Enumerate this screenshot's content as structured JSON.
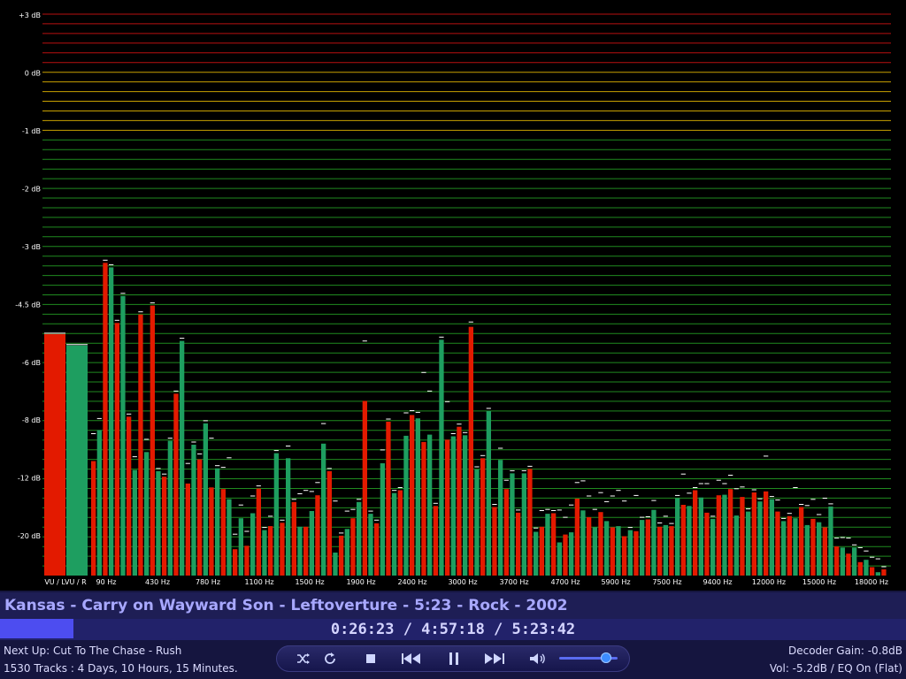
{
  "chart_data": {
    "type": "bar",
    "title": "",
    "ylabels": [
      "+3 dB",
      "0 dB",
      "-1 dB",
      "-2 dB",
      "-3 dB",
      "-4.5 dB",
      "-6 dB",
      "-8 dB",
      "-12 dB",
      "-20 dB"
    ],
    "xlabels": [
      "VU / LVU / R",
      "90 Hz",
      "430 Hz",
      "780 Hz",
      "1100 Hz",
      "1500 Hz",
      "1900 Hz",
      "2400 Hz",
      "3000 Hz",
      "3700 Hz",
      "4700 Hz",
      "5900 Hz",
      "7500 Hz",
      "9400 Hz",
      "12000 Hz",
      "15000 Hz",
      "18000 Hz"
    ],
    "vu": [
      {
        "channel": "L",
        "level": 0.43,
        "color": "#e31a00"
      },
      {
        "channel": "R",
        "level": 0.41,
        "color": "#1e9e60"
      }
    ],
    "bars": [
      {
        "level": 0.204,
        "peak": 0.248
      },
      {
        "level": 0.259,
        "peak": 0.275
      },
      {
        "level": 0.557,
        "peak": 0.557
      },
      {
        "level": 0.549,
        "peak": 0.549
      },
      {
        "level": 0.45,
        "peak": 0.45
      },
      {
        "level": 0.498,
        "peak": 0.498
      },
      {
        "level": 0.283,
        "peak": 0.283
      },
      {
        "level": 0.188,
        "peak": 0.207
      },
      {
        "level": 0.465,
        "peak": 0.465
      },
      {
        "level": 0.22,
        "peak": 0.238
      },
      {
        "level": 0.481,
        "peak": 0.481
      },
      {
        "level": 0.186,
        "peak": 0.186
      },
      {
        "level": 0.176,
        "peak": 0.176
      },
      {
        "level": 0.24,
        "peak": 0.24
      },
      {
        "level": 0.324,
        "peak": 0.324
      },
      {
        "level": 0.418,
        "peak": 0.418
      },
      {
        "level": 0.164,
        "peak": 0.195
      },
      {
        "level": 0.233,
        "peak": 0.233
      },
      {
        "level": 0.207,
        "peak": 0.212
      },
      {
        "level": 0.271,
        "peak": 0.271
      },
      {
        "level": 0.157,
        "peak": 0.24
      },
      {
        "level": 0.191,
        "peak": 0.191
      },
      {
        "level": 0.154,
        "peak": 0.188
      },
      {
        "level": 0.136,
        "peak": 0.205
      },
      {
        "level": 0.047,
        "peak": 0.069
      },
      {
        "level": 0.102,
        "peak": 0.121
      },
      {
        "level": 0.053,
        "peak": 0.074
      },
      {
        "level": 0.111,
        "peak": 0.137
      },
      {
        "level": 0.155,
        "peak": 0.155
      },
      {
        "level": 0.081,
        "peak": 0.081
      },
      {
        "level": 0.088,
        "peak": 0.101
      },
      {
        "level": 0.218,
        "peak": 0.218
      },
      {
        "level": 0.094,
        "peak": 0.094
      },
      {
        "level": 0.209,
        "peak": 0.226
      },
      {
        "level": 0.131,
        "peak": 0.131
      },
      {
        "level": 0.087,
        "peak": 0.141
      },
      {
        "level": 0.087,
        "peak": 0.147
      },
      {
        "level": 0.115,
        "peak": 0.145
      },
      {
        "level": 0.143,
        "peak": 0.161
      },
      {
        "level": 0.235,
        "peak": 0.266
      },
      {
        "level": 0.186,
        "peak": 0.186
      },
      {
        "level": 0.041,
        "peak": 0.128
      },
      {
        "level": 0.071,
        "peak": 0.071
      },
      {
        "level": 0.083,
        "peak": 0.11
      },
      {
        "level": 0.102,
        "peak": 0.113
      },
      {
        "level": 0.131,
        "peak": 0.131
      },
      {
        "level": 0.311,
        "peak": 0.413
      },
      {
        "level": 0.11,
        "peak": 0.11
      },
      {
        "level": 0.093,
        "peak": 0.094
      },
      {
        "level": 0.2,
        "peak": 0.219
      },
      {
        "level": 0.274,
        "peak": 0.274
      },
      {
        "level": 0.147,
        "peak": 0.147
      },
      {
        "level": 0.152,
        "peak": 0.152
      },
      {
        "level": 0.249,
        "peak": 0.285
      },
      {
        "level": 0.286,
        "peak": 0.289
      },
      {
        "level": 0.28,
        "peak": 0.286
      },
      {
        "level": 0.238,
        "peak": 0.357
      },
      {
        "level": 0.251,
        "peak": 0.324
      },
      {
        "level": 0.124,
        "peak": 0.124
      },
      {
        "level": 0.42,
        "peak": 0.42
      },
      {
        "level": 0.242,
        "peak": 0.305
      },
      {
        "level": 0.248,
        "peak": 0.248
      },
      {
        "level": 0.265,
        "peak": 0.265
      },
      {
        "level": 0.25,
        "peak": 0.25
      },
      {
        "level": 0.443,
        "peak": 0.447
      },
      {
        "level": 0.189,
        "peak": 0.189
      },
      {
        "level": 0.209,
        "peak": 0.209
      },
      {
        "level": 0.293,
        "peak": 0.293
      },
      {
        "level": 0.122,
        "peak": 0.122
      },
      {
        "level": 0.206,
        "peak": 0.222
      },
      {
        "level": 0.154,
        "peak": 0.165
      },
      {
        "level": 0.182,
        "peak": 0.182
      },
      {
        "level": 0.112,
        "peak": 0.112
      },
      {
        "level": 0.182,
        "peak": 0.182
      },
      {
        "level": 0.19,
        "peak": 0.19
      },
      {
        "level": 0.078,
        "peak": 0.08
      },
      {
        "level": 0.087,
        "peak": 0.111
      },
      {
        "level": 0.11,
        "peak": 0.113
      },
      {
        "level": 0.111,
        "peak": 0.111
      },
      {
        "level": 0.059,
        "peak": 0.112
      },
      {
        "level": 0.073,
        "peak": 0.099
      },
      {
        "level": 0.077,
        "peak": 0.121
      },
      {
        "level": 0.137,
        "peak": 0.161
      },
      {
        "level": 0.116,
        "peak": 0.164
      },
      {
        "level": 0.104,
        "peak": 0.137
      },
      {
        "level": 0.086,
        "peak": 0.113
      },
      {
        "level": 0.113,
        "peak": 0.143
      },
      {
        "level": 0.097,
        "peak": 0.127
      },
      {
        "level": 0.086,
        "peak": 0.137
      },
      {
        "level": 0.088,
        "peak": 0.147
      },
      {
        "level": 0.07,
        "peak": 0.128
      },
      {
        "level": 0.081,
        "peak": 0.081
      },
      {
        "level": 0.079,
        "peak": 0.138
      },
      {
        "level": 0.099,
        "peak": 0.099
      },
      {
        "level": 0.1,
        "peak": 0.1
      },
      {
        "level": 0.117,
        "peak": 0.129
      },
      {
        "level": 0.087,
        "peak": 0.089
      },
      {
        "level": 0.09,
        "peak": 0.101
      },
      {
        "level": 0.088,
        "peak": 0.088
      },
      {
        "level": 0.138,
        "peak": 0.138
      },
      {
        "level": 0.126,
        "peak": 0.176
      },
      {
        "level": 0.124,
        "peak": 0.142
      },
      {
        "level": 0.152,
        "peak": 0.152
      },
      {
        "level": 0.139,
        "peak": 0.159
      },
      {
        "level": 0.112,
        "peak": 0.159
      },
      {
        "level": 0.101,
        "peak": 0.101
      },
      {
        "level": 0.143,
        "peak": 0.165
      },
      {
        "level": 0.144,
        "peak": 0.159
      },
      {
        "level": 0.154,
        "peak": 0.174
      },
      {
        "level": 0.107,
        "peak": 0.15
      },
      {
        "level": 0.14,
        "peak": 0.153
      },
      {
        "level": 0.114,
        "peak": 0.114
      },
      {
        "level": 0.148,
        "peak": 0.148
      },
      {
        "level": 0.132,
        "peak": 0.132
      },
      {
        "level": 0.15,
        "peak": 0.208
      },
      {
        "level": 0.136,
        "peak": 0.136
      },
      {
        "level": 0.114,
        "peak": 0.13
      },
      {
        "level": 0.097,
        "peak": 0.097
      },
      {
        "level": 0.106,
        "peak": 0.106
      },
      {
        "level": 0.102,
        "peak": 0.152
      },
      {
        "level": 0.122,
        "peak": 0.122
      },
      {
        "level": 0.09,
        "peak": 0.12
      },
      {
        "level": 0.101,
        "peak": 0.131
      },
      {
        "level": 0.095,
        "peak": 0.104
      },
      {
        "level": 0.086,
        "peak": 0.133
      },
      {
        "level": 0.123,
        "peak": 0.123
      },
      {
        "level": 0.052,
        "peak": 0.062
      },
      {
        "level": 0.05,
        "peak": 0.063
      },
      {
        "level": 0.039,
        "peak": 0.062
      },
      {
        "level": 0.05,
        "peak": 0.05
      },
      {
        "level": 0.024,
        "peak": 0.045
      },
      {
        "level": 0.028,
        "peak": 0.039
      },
      {
        "level": 0.015,
        "peak": 0.028
      },
      {
        "level": 0.006,
        "peak": 0.025
      },
      {
        "level": 0.011,
        "peak": 0.011
      }
    ],
    "colors": {
      "bar_a": "#e31a00",
      "bar_b": "#1e9e60",
      "grid_top": "#b81010",
      "grid_mid": "#c8a000",
      "grid_low": "#1f8a1f",
      "peak": "#ffffff"
    },
    "grid": true
  },
  "now_playing": {
    "title": "Kansas - Carry on Wayward Son - Leftoverture - 5:23 - Rock - 2002",
    "progress": 0.081,
    "time": "0:26:23 / 4:57:18 / 5:23:42"
  },
  "status": {
    "next_up": "Next Up: Cut To The Chase - Rush",
    "library": "1530 Tracks : 4 Days, 10 Hours, 15 Minutes.",
    "decoder_gain": "Decoder Gain: -0.8dB",
    "volume_eq": "Vol: -5.2dB / EQ On (Flat)"
  },
  "controls": {
    "volume": 0.8,
    "icons": [
      "shuffle-icon",
      "repeat-icon",
      "stop-icon",
      "previous-icon",
      "pause-icon",
      "next-icon",
      "speaker-icon"
    ]
  }
}
